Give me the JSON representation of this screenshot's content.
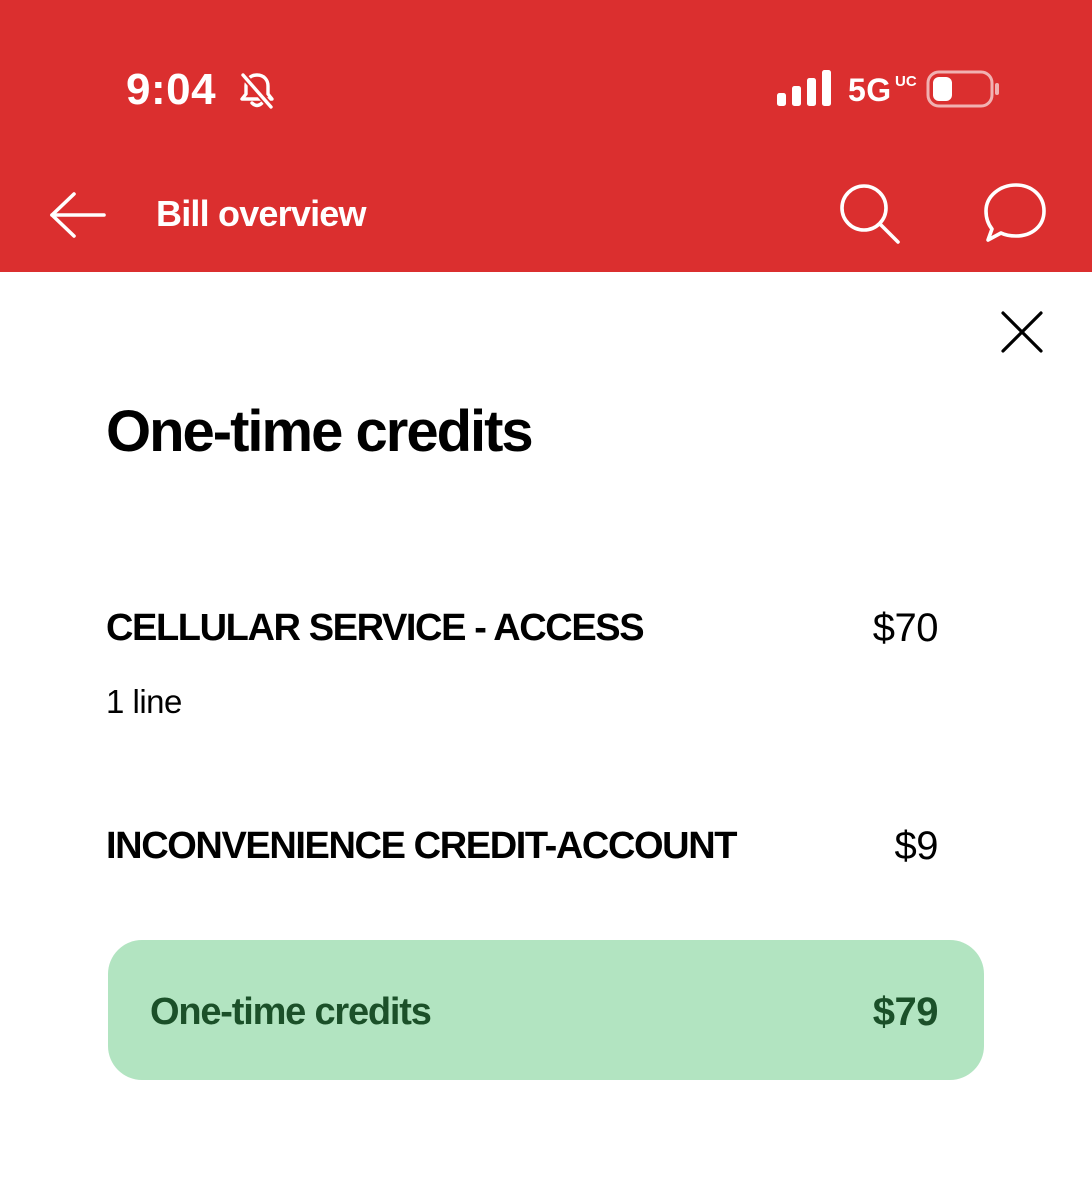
{
  "status_bar": {
    "time": "9:04",
    "network": "5G",
    "network_super": "UC",
    "icons": [
      "bell-slash-icon",
      "cellular-signal-icon",
      "battery-icon"
    ],
    "battery_level": 0.35
  },
  "header": {
    "title": "Bill overview",
    "background_color": "#db2f2f",
    "icons": [
      "back-arrow-icon",
      "search-icon",
      "chat-bubble-icon"
    ]
  },
  "modal": {
    "close_icon": "close-icon",
    "title": "One-time credits",
    "items": [
      {
        "name": "CELLULAR SERVICE - ACCESS",
        "detail": "1 line",
        "amount": "$70"
      },
      {
        "name": "INCONVENIENCE CREDIT-ACCOUNT",
        "amount": "$9"
      }
    ],
    "total": {
      "label": "One-time credits",
      "amount": "$79",
      "background_color": "#b2e4c1",
      "text_color": "#1b5029"
    }
  }
}
